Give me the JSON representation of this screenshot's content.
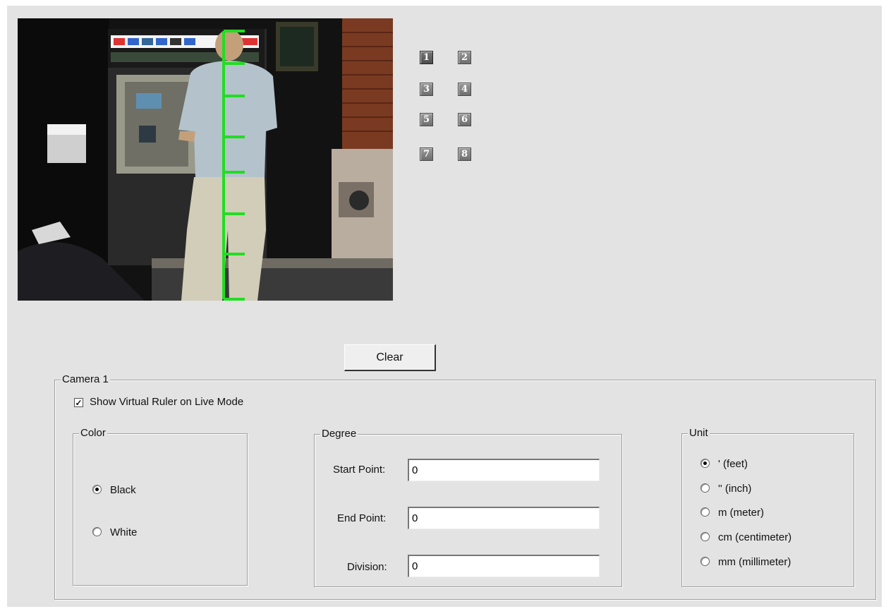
{
  "camera_buttons": [
    "1",
    "2",
    "3",
    "4",
    "5",
    "6",
    "7",
    "8"
  ],
  "active_camera": "1",
  "clear_label": "Clear",
  "camera_group": {
    "title": "Camera 1",
    "show_ruler_label": "Show Virtual Ruler on Live Mode",
    "show_ruler_checked": true
  },
  "color_group": {
    "title": "Color",
    "options": [
      "Black",
      "White"
    ],
    "selected": "Black"
  },
  "degree_group": {
    "title": "Degree",
    "start_label": "Start Point:",
    "start_value": "0",
    "end_label": "End Point:",
    "end_value": "0",
    "division_label": "Division:",
    "division_value": "0"
  },
  "unit_group": {
    "title": "Unit",
    "options": [
      "' (feet)",
      "'' (inch)",
      "m (meter)",
      "cm (centimeter)",
      "mm (millimeter)"
    ],
    "selected": "' (feet)"
  },
  "ruler_color": "#22dd22"
}
